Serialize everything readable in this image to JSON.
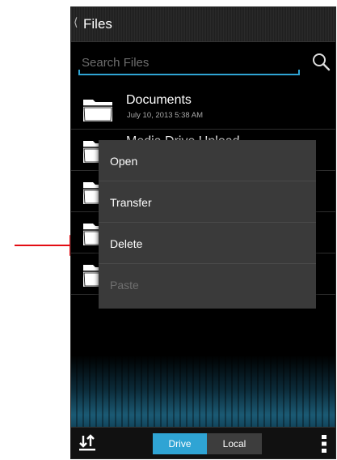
{
  "header": {
    "back_icon": "chevron-left-icon",
    "title": "Files"
  },
  "search": {
    "placeholder": "Search Files",
    "value": "",
    "icon": "search-icon"
  },
  "files": [
    {
      "name": "Documents",
      "date": "July 10, 2013 5:38 AM",
      "icon": "folder-icon"
    },
    {
      "name": "Media Drive Upload",
      "date": "",
      "icon": "folder-icon"
    },
    {
      "name": "",
      "date": "",
      "icon": "folder-icon"
    },
    {
      "name": "",
      "date": "",
      "icon": "folder-icon"
    },
    {
      "name": "",
      "date": "",
      "icon": "folder-icon"
    }
  ],
  "context_menu": {
    "items": [
      {
        "label": "Open",
        "enabled": true
      },
      {
        "label": "Transfer",
        "enabled": true
      },
      {
        "label": "Delete",
        "enabled": true
      },
      {
        "label": "Paste",
        "enabled": false
      }
    ]
  },
  "bottom_bar": {
    "sort_icon": "sort-arrows-icon",
    "tabs": [
      {
        "label": "Drive",
        "selected": true
      },
      {
        "label": "Local",
        "selected": false
      }
    ],
    "overflow_icon": "overflow-menu-icon"
  },
  "colors": {
    "accent": "#2fa4d4",
    "annotation_arrow": "#e30d13",
    "menu_background": "#3a3a3a",
    "disabled_text": "#6f6f6f"
  }
}
